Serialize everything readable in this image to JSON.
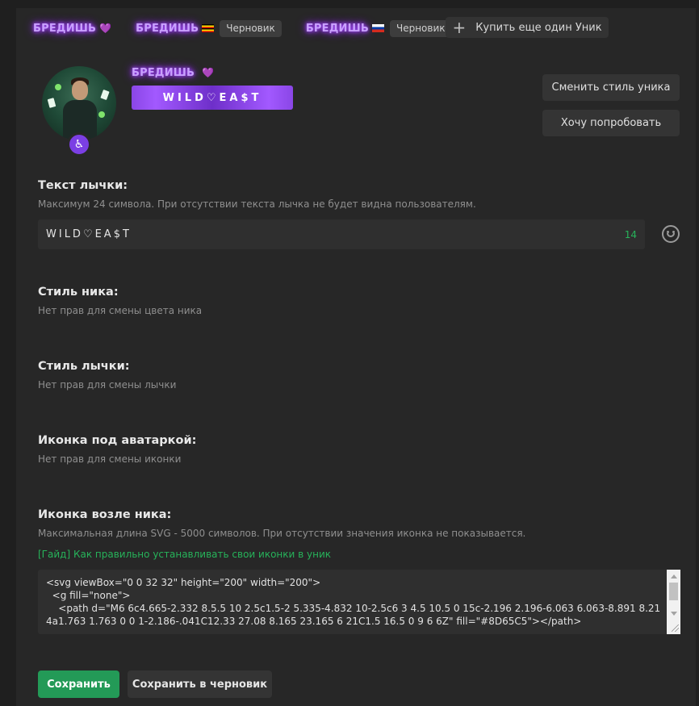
{
  "tabs": [
    {
      "name": "БРЕДИШЬ",
      "heart": "💜",
      "flag": null,
      "badge": null
    },
    {
      "name": "БРЕДИШЬ",
      "heart": null,
      "flag": "uganda-flag",
      "badge": "Черновик"
    },
    {
      "name": "БРЕДИШЬ",
      "heart": null,
      "flag": "russia-flag",
      "badge": "Черновик"
    }
  ],
  "buy_button": {
    "icon": "plus-icon",
    "label": "Купить еще один Уник"
  },
  "profile": {
    "name": "БРЕДИШЬ",
    "heart": "💜",
    "tag": "WILD♡EA$T",
    "avatar_badge_icon": "wheelchair-icon"
  },
  "side_buttons": {
    "change_style": "Сменить стиль уника",
    "try": "Хочу попробовать"
  },
  "tag_text": {
    "title": "Текст лычки:",
    "hint": "Максимум 24 символа. При отсутствии текста лычка не будет видна пользователям.",
    "value": "WILD♡EA$T",
    "char_count": "14",
    "emoji_icon": "smiley-icon"
  },
  "nick_style": {
    "title": "Стиль ника:",
    "hint": "Нет прав для смены цвета ника"
  },
  "tag_style": {
    "title": "Стиль лычки:",
    "hint": "Нет прав для смены лычки"
  },
  "avatar_icon": {
    "title": "Иконка под аватаркой:",
    "hint": "Нет прав для смены иконки"
  },
  "nick_icon": {
    "title": "Иконка возле ника:",
    "hint": "Максимальная длина SVG - 5000 символов. При отсутствии значения иконка не показывается.",
    "guide_link": "[Гайд] Как правильно устанавливать свои иконки в уник",
    "svg_value": "<svg viewBox=\"0 0 32 32\" height=\"200\" width=\"200\">\n  <g fill=\"none\">\n    <path d=\"M6 6c4.665-2.332 8.5.5 10 2.5c1.5-2 5.335-4.832 10-2.5c6 3 4.5 10.5 0 15c-2.196 2.196-6.063 6.063-8.891 8.214a1.763 1.763 0 0 1-2.186-.041C12.33 27.08 8.165 23.165 6 21C1.5 16.5 0 9 6 6Z\" fill=\"#8D65C5\"></path>"
  },
  "actions": {
    "save": "Сохранить",
    "save_draft": "Сохранить в черновик"
  },
  "colors": {
    "background": "#272727",
    "accent_green": "#239a57",
    "link_green": "#27b35a",
    "tag_purple": "#a259ff",
    "glow_purple": "#c9a0ff"
  }
}
